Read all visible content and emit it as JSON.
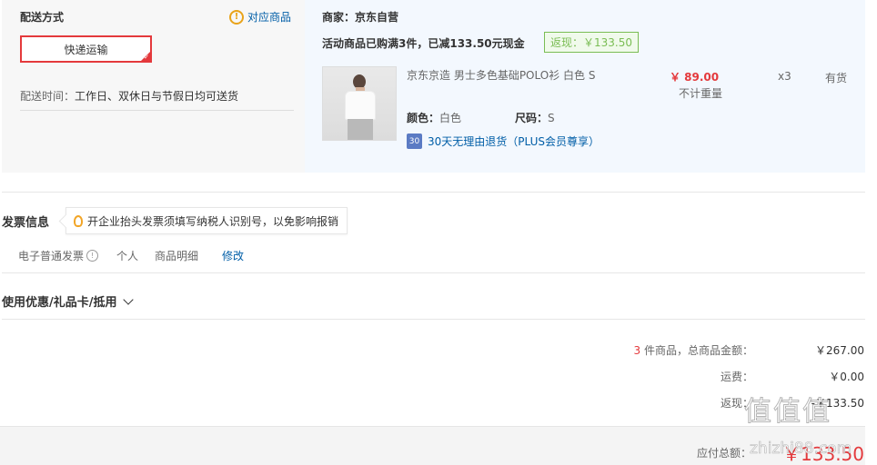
{
  "shipping": {
    "title": "配送方式",
    "match_link": "对应商品",
    "method": "快递运输",
    "time_label": "配送时间：",
    "time_value": "工作日、双休日与节假日均可送货"
  },
  "order": {
    "seller": "商家：京东自营",
    "promo": "活动商品已购满3件，已减133.50元现金",
    "rebate": "返现：￥133.50",
    "product": {
      "name": "京东京造 男士多色基础POLO衫 白色 S",
      "price": "￥ 89.00",
      "weight": "不计重量",
      "qty": "x3",
      "stock": "有货",
      "color_label": "颜色：",
      "color_value": "白色",
      "size_label": "尺码：",
      "size_value": "S",
      "return_icon": "30",
      "return_text": "30天无理由退货（PLUS会员尊享）"
    }
  },
  "invoice": {
    "title": "发票信息",
    "tip": "开企业抬头发票须填写纳税人识别号，以免影响报销",
    "type": "电子普通发票",
    "title_type": "个人",
    "content": "商品明细",
    "edit": "修改"
  },
  "coupon": {
    "label": "使用优惠/礼品卡/抵用"
  },
  "summary": {
    "count": "3",
    "count_suffix": " 件商品，总商品金额：",
    "total": "￥267.00",
    "freight_label": "运费：",
    "freight": "￥0.00",
    "rebate_label": "返现：",
    "rebate": "-￥133.50",
    "pay_label": "应付总额：",
    "pay_total": "￥133.50"
  },
  "watermark": {
    "cn": "值值值",
    "site": "zhizhi88.com"
  },
  "colors": {
    "accent_red": "#e4393c",
    "link_blue": "#005ea7",
    "rebate_green": "#7abd54"
  }
}
